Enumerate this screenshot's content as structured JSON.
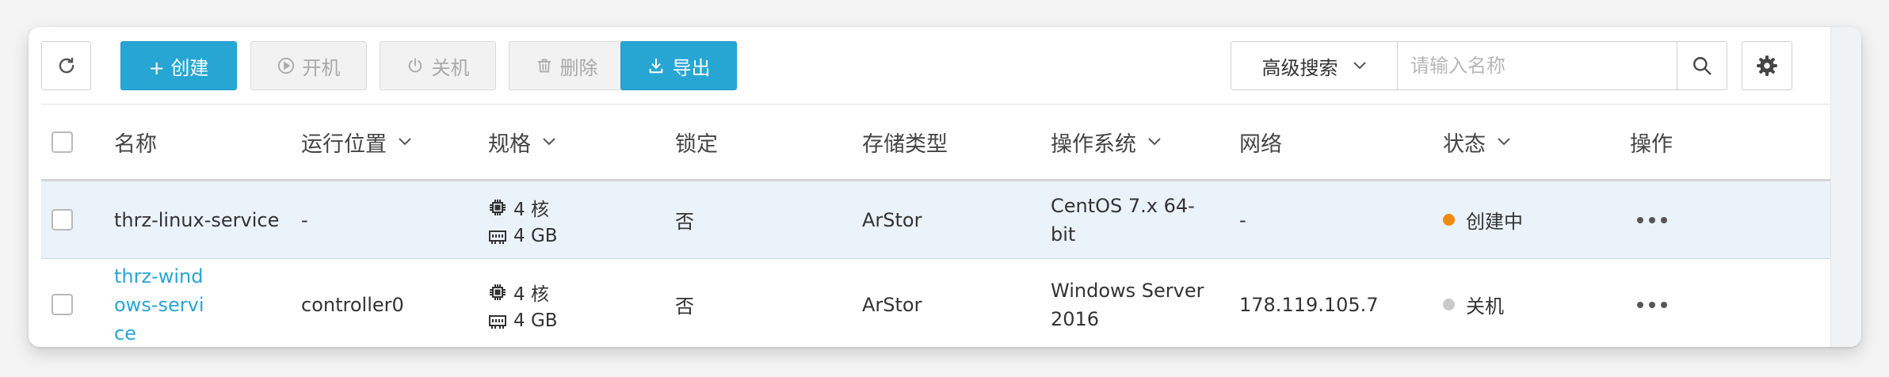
{
  "colors": {
    "primary": "#27a6d3",
    "status_creating": "#ef8a13",
    "status_off": "#c9c9c9",
    "row_highlight": "#eaf2fa"
  },
  "toolbar": {
    "refresh_icon": "refresh-icon",
    "create_label": "+ 创建",
    "start_label": "开机",
    "shutdown_label": "关机",
    "delete_label": "删除",
    "export_label": "导出",
    "search_type_label": "高级搜索",
    "search_placeholder": "请输入名称",
    "search_value": "",
    "settings_icon": "gear-icon"
  },
  "table": {
    "columns": [
      "名称",
      "运行位置",
      "规格",
      "锁定",
      "存储类型",
      "操作系统",
      "网络",
      "状态",
      "操作"
    ],
    "rows": [
      {
        "name": "thrz-linux-service",
        "location": "-",
        "cpu": "4 核",
        "memory": "4 GB",
        "locked": "否",
        "storage": "ArStor",
        "os": "CentOS 7.x 64-bit",
        "network": "-",
        "status": "创建中",
        "status_color": "#ef8a13"
      },
      {
        "name": "thrz-windows-service",
        "location": "controller0",
        "cpu": "4 核",
        "memory": "4 GB",
        "locked": "否",
        "storage": "ArStor",
        "os": "Windows Server 2016",
        "network": "178.119.105.7",
        "status": "关机",
        "status_color": "#c9c9c9"
      }
    ]
  }
}
